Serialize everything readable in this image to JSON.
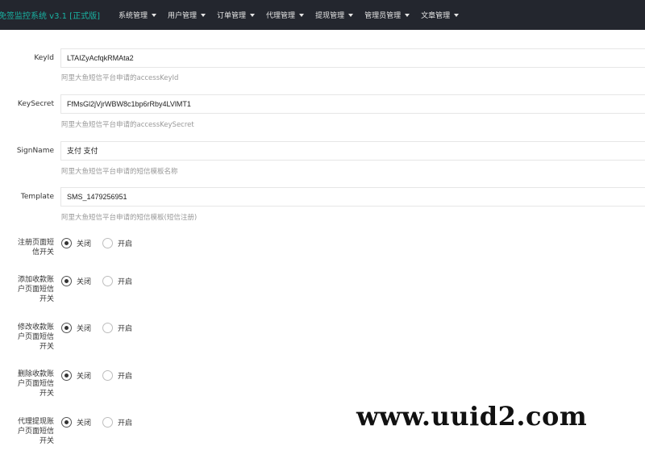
{
  "header": {
    "brand": "免签监控系统 v3.1 [正式版]",
    "nav": [
      {
        "label": "系统管理"
      },
      {
        "label": "用户管理"
      },
      {
        "label": "订单管理"
      },
      {
        "label": "代理管理"
      },
      {
        "label": "提现管理"
      },
      {
        "label": "管理员管理"
      },
      {
        "label": "文章管理"
      }
    ]
  },
  "fields": [
    {
      "label": "KeyId",
      "value": "LTAIZyAcfqkRMAta2",
      "hint": "阿里大鱼短信平台申请的accessKeyId"
    },
    {
      "label": "KeySecret",
      "value": "FfMsGl2jVjrWBW8c1bp6rRby4LVlMT1",
      "hint": "阿里大鱼短信平台申请的accessKeySecret"
    },
    {
      "label": "SignName",
      "value": "支付 支付",
      "hint": "阿里大鱼短信平台申请的短信模板名称"
    },
    {
      "label": "Template",
      "value": "SMS_1479256951",
      "hint": "阿里大鱼短信平台申请的短信模板(短信注册)"
    }
  ],
  "switches": [
    {
      "label_lines": [
        "注册页面短",
        "信开关"
      ],
      "off": "关闭",
      "on": "开启",
      "selected": "off"
    },
    {
      "label_lines": [
        "添加收款账",
        "户页面短信",
        "开关"
      ],
      "off": "关闭",
      "on": "开启",
      "selected": "off"
    },
    {
      "label_lines": [
        "修改收款账",
        "户页面短信",
        "开关"
      ],
      "off": "关闭",
      "on": "开启",
      "selected": "off"
    },
    {
      "label_lines": [
        "删除收款账",
        "户页面短信",
        "开关"
      ],
      "off": "关闭",
      "on": "开启",
      "selected": "off"
    },
    {
      "label_lines": [
        "代理提现账",
        "户页面短信",
        "开关"
      ],
      "off": "关闭",
      "on": "开启",
      "selected": "off"
    }
  ],
  "watermark": "www.uuid2.com"
}
